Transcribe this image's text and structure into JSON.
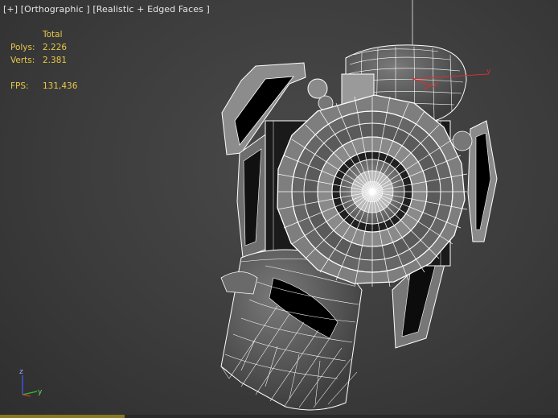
{
  "viewport": {
    "label": "[+] [Orthographic ] [Realistic + Edged Faces ]",
    "stats": {
      "header": "Total",
      "polys_label": "Polys:",
      "polys_value": "2.226",
      "verts_label": "Verts:",
      "verts_value": "2.381",
      "fps_label": "FPS:",
      "fps_value": "131,436"
    },
    "gizmo": {
      "y_label": "y"
    },
    "axis_tripod": {
      "z_label": "z",
      "y_label": "y"
    }
  },
  "colors": {
    "stats_text": "#e8c848",
    "label_text": "#e6e6e6",
    "gizmo_red": "#d63030",
    "axis_green": "#30c030",
    "axis_blue": "#4060ff"
  },
  "icons": [
    "axis-tripod-icon",
    "transform-gizmo-icon"
  ]
}
